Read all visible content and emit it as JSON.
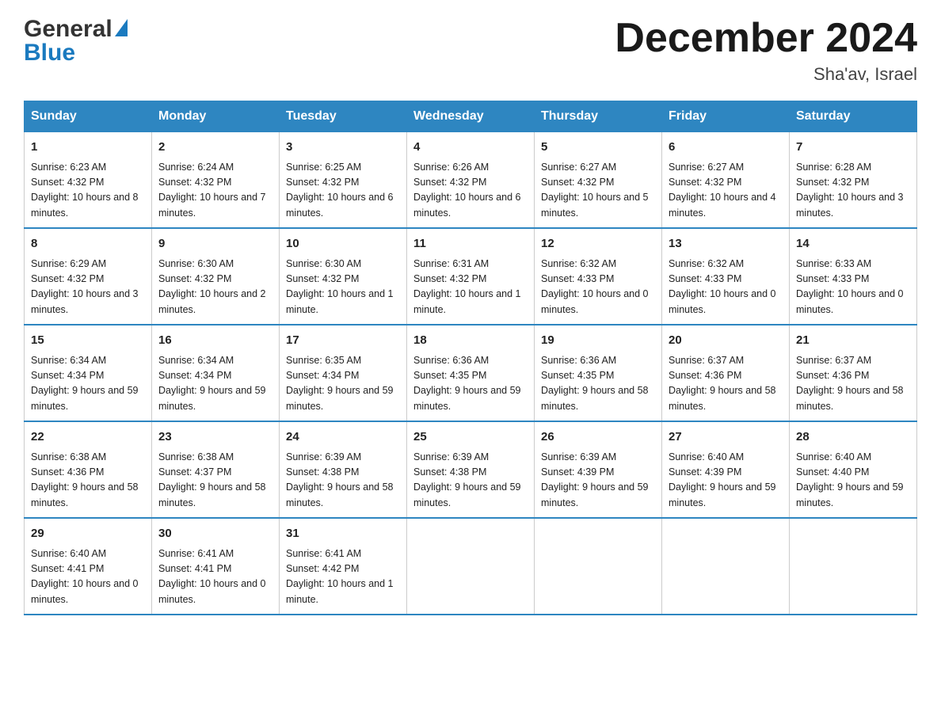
{
  "header": {
    "title": "December 2024",
    "subtitle": "Sha'av, Israel",
    "logo_general": "General",
    "logo_blue": "Blue"
  },
  "days_of_week": [
    "Sunday",
    "Monday",
    "Tuesday",
    "Wednesday",
    "Thursday",
    "Friday",
    "Saturday"
  ],
  "weeks": [
    [
      {
        "day": "1",
        "sunrise": "6:23 AM",
        "sunset": "4:32 PM",
        "daylight": "10 hours and 8 minutes."
      },
      {
        "day": "2",
        "sunrise": "6:24 AM",
        "sunset": "4:32 PM",
        "daylight": "10 hours and 7 minutes."
      },
      {
        "day": "3",
        "sunrise": "6:25 AM",
        "sunset": "4:32 PM",
        "daylight": "10 hours and 6 minutes."
      },
      {
        "day": "4",
        "sunrise": "6:26 AM",
        "sunset": "4:32 PM",
        "daylight": "10 hours and 6 minutes."
      },
      {
        "day": "5",
        "sunrise": "6:27 AM",
        "sunset": "4:32 PM",
        "daylight": "10 hours and 5 minutes."
      },
      {
        "day": "6",
        "sunrise": "6:27 AM",
        "sunset": "4:32 PM",
        "daylight": "10 hours and 4 minutes."
      },
      {
        "day": "7",
        "sunrise": "6:28 AM",
        "sunset": "4:32 PM",
        "daylight": "10 hours and 3 minutes."
      }
    ],
    [
      {
        "day": "8",
        "sunrise": "6:29 AM",
        "sunset": "4:32 PM",
        "daylight": "10 hours and 3 minutes."
      },
      {
        "day": "9",
        "sunrise": "6:30 AM",
        "sunset": "4:32 PM",
        "daylight": "10 hours and 2 minutes."
      },
      {
        "day": "10",
        "sunrise": "6:30 AM",
        "sunset": "4:32 PM",
        "daylight": "10 hours and 1 minute."
      },
      {
        "day": "11",
        "sunrise": "6:31 AM",
        "sunset": "4:32 PM",
        "daylight": "10 hours and 1 minute."
      },
      {
        "day": "12",
        "sunrise": "6:32 AM",
        "sunset": "4:33 PM",
        "daylight": "10 hours and 0 minutes."
      },
      {
        "day": "13",
        "sunrise": "6:32 AM",
        "sunset": "4:33 PM",
        "daylight": "10 hours and 0 minutes."
      },
      {
        "day": "14",
        "sunrise": "6:33 AM",
        "sunset": "4:33 PM",
        "daylight": "10 hours and 0 minutes."
      }
    ],
    [
      {
        "day": "15",
        "sunrise": "6:34 AM",
        "sunset": "4:34 PM",
        "daylight": "9 hours and 59 minutes."
      },
      {
        "day": "16",
        "sunrise": "6:34 AM",
        "sunset": "4:34 PM",
        "daylight": "9 hours and 59 minutes."
      },
      {
        "day": "17",
        "sunrise": "6:35 AM",
        "sunset": "4:34 PM",
        "daylight": "9 hours and 59 minutes."
      },
      {
        "day": "18",
        "sunrise": "6:36 AM",
        "sunset": "4:35 PM",
        "daylight": "9 hours and 59 minutes."
      },
      {
        "day": "19",
        "sunrise": "6:36 AM",
        "sunset": "4:35 PM",
        "daylight": "9 hours and 58 minutes."
      },
      {
        "day": "20",
        "sunrise": "6:37 AM",
        "sunset": "4:36 PM",
        "daylight": "9 hours and 58 minutes."
      },
      {
        "day": "21",
        "sunrise": "6:37 AM",
        "sunset": "4:36 PM",
        "daylight": "9 hours and 58 minutes."
      }
    ],
    [
      {
        "day": "22",
        "sunrise": "6:38 AM",
        "sunset": "4:36 PM",
        "daylight": "9 hours and 58 minutes."
      },
      {
        "day": "23",
        "sunrise": "6:38 AM",
        "sunset": "4:37 PM",
        "daylight": "9 hours and 58 minutes."
      },
      {
        "day": "24",
        "sunrise": "6:39 AM",
        "sunset": "4:38 PM",
        "daylight": "9 hours and 58 minutes."
      },
      {
        "day": "25",
        "sunrise": "6:39 AM",
        "sunset": "4:38 PM",
        "daylight": "9 hours and 59 minutes."
      },
      {
        "day": "26",
        "sunrise": "6:39 AM",
        "sunset": "4:39 PM",
        "daylight": "9 hours and 59 minutes."
      },
      {
        "day": "27",
        "sunrise": "6:40 AM",
        "sunset": "4:39 PM",
        "daylight": "9 hours and 59 minutes."
      },
      {
        "day": "28",
        "sunrise": "6:40 AM",
        "sunset": "4:40 PM",
        "daylight": "9 hours and 59 minutes."
      }
    ],
    [
      {
        "day": "29",
        "sunrise": "6:40 AM",
        "sunset": "4:41 PM",
        "daylight": "10 hours and 0 minutes."
      },
      {
        "day": "30",
        "sunrise": "6:41 AM",
        "sunset": "4:41 PM",
        "daylight": "10 hours and 0 minutes."
      },
      {
        "day": "31",
        "sunrise": "6:41 AM",
        "sunset": "4:42 PM",
        "daylight": "10 hours and 1 minute."
      },
      null,
      null,
      null,
      null
    ]
  ],
  "labels": {
    "sunrise_prefix": "Sunrise: ",
    "sunset_prefix": "Sunset: ",
    "daylight_prefix": "Daylight: "
  }
}
